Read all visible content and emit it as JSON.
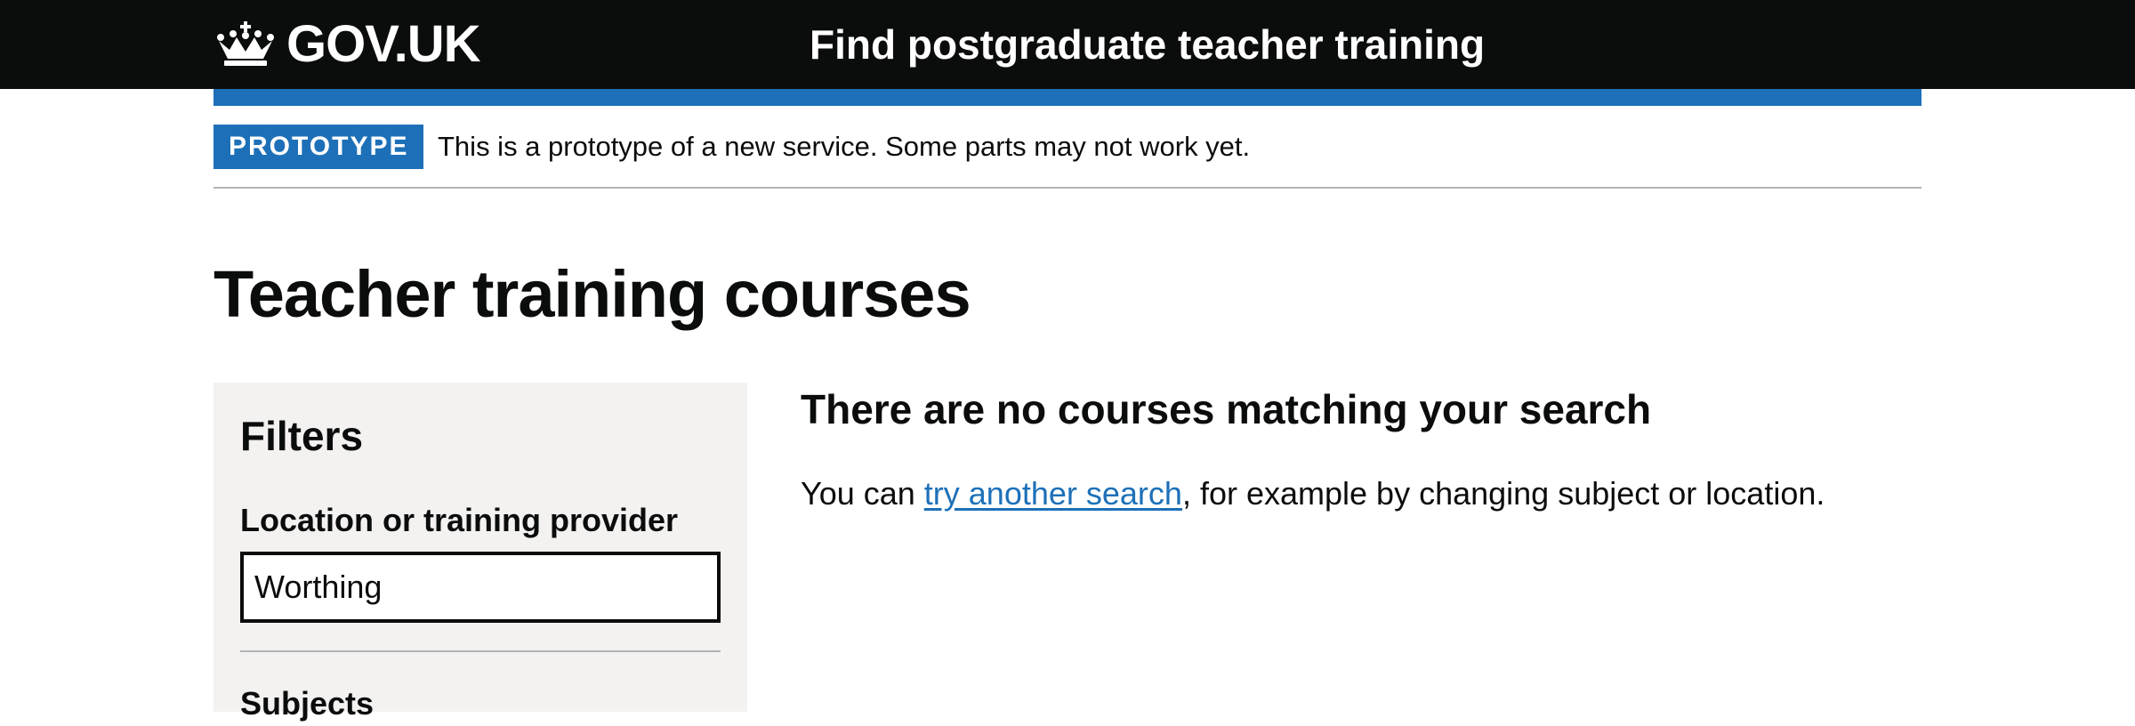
{
  "header": {
    "logo_text": "GOV.UK",
    "service_name": "Find postgraduate teacher training",
    "logo_icon": "crown-icon"
  },
  "phase_banner": {
    "tag": "PROTOTYPE",
    "text": "This is a prototype of a new service. Some parts may not work yet."
  },
  "main": {
    "title": "Teacher training courses"
  },
  "filters": {
    "heading": "Filters",
    "location_label": "Location or training provider",
    "location_value": "Worthing",
    "subjects_heading": "Subjects"
  },
  "results": {
    "heading": "There are no courses matching your search",
    "text_prefix": "You can ",
    "link_text": "try another search",
    "text_suffix": ", for example by changing subject or location."
  },
  "colors": {
    "header_bg": "#0b0c0c",
    "brand_blue": "#1d70b8",
    "panel_bg": "#f3f2f1",
    "divider": "#b1b4b6"
  }
}
